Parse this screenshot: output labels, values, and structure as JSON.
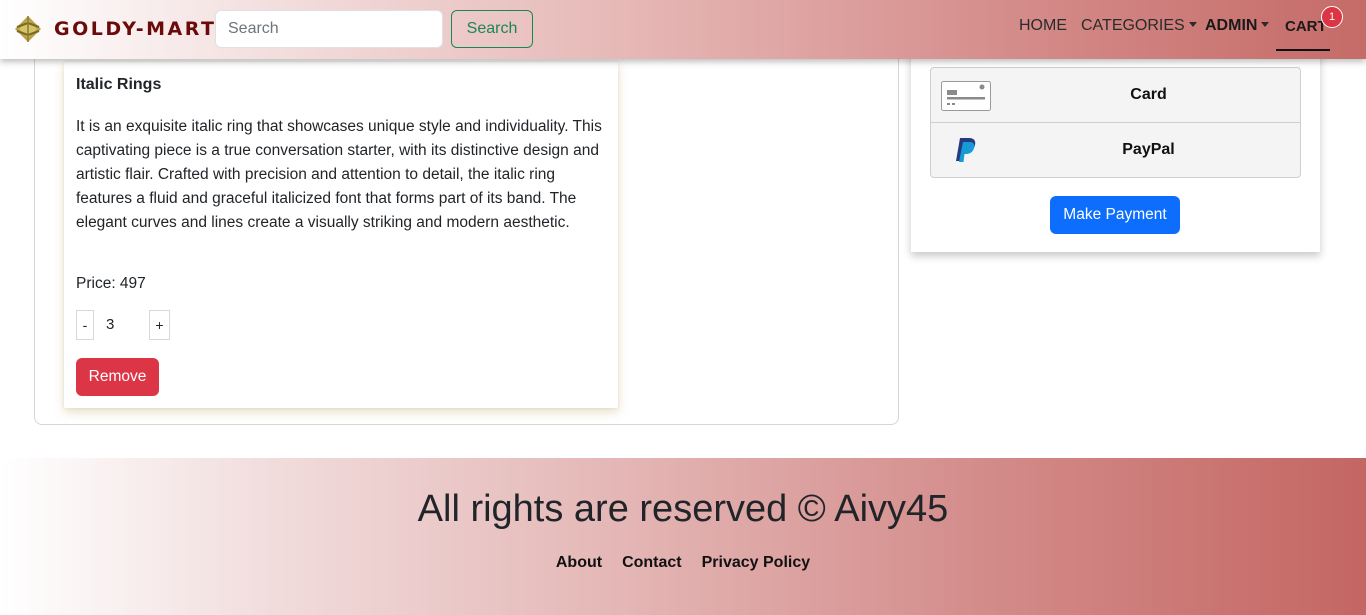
{
  "navbar": {
    "brand": "GOLDY-MART",
    "search_placeholder": "Search",
    "search_button": "Search",
    "links": {
      "home": "HOME",
      "categories": "CATEGORIES",
      "admin": "ADMIN",
      "cart": "CART"
    },
    "cart_count": "1"
  },
  "cart": {
    "item": {
      "name": "Italic Rings",
      "description": "It is an exquisite italic ring that showcases unique style and individuality. This captivating piece is a true conversation starter, with its distinctive design and artistic flair. Crafted with precision and attention to detail, the italic ring features a fluid and graceful italicized font that forms part of its band. The elegant curves and lines create a visually striking and modern aesthetic.",
      "price_label": "Price: 497",
      "quantity": "3",
      "minus": "-",
      "plus": "+",
      "remove_label": "Remove"
    }
  },
  "payment": {
    "options": [
      "Card",
      "PayPal"
    ],
    "button": "Make Payment"
  },
  "footer": {
    "title": "All rights are reserved © Aivy45",
    "links": [
      "About",
      "Contact",
      "Privacy Policy"
    ]
  },
  "colors": {
    "brand_text": "#6b0a0a",
    "search_green": "#198754",
    "remove_red": "#dc3545",
    "payment_blue": "#0d6efd",
    "badge_red": "#dc3545"
  },
  "icons": {
    "logo": "diamond-leaf-logo",
    "card": "credit-card-icon",
    "paypal": "paypal-icon"
  }
}
